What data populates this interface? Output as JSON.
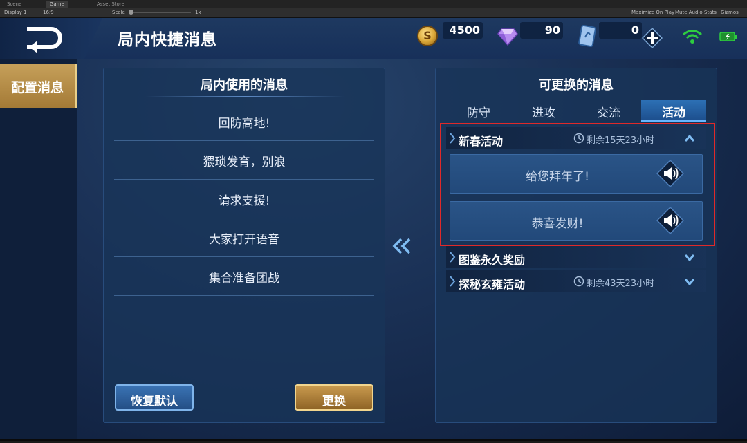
{
  "editor": {
    "tabs": [
      "Scene",
      "Game",
      "Asset Store"
    ],
    "display": "Display 1",
    "aspect": "16:9",
    "scale_label": "Scale",
    "scale_value": "1x",
    "right_items": [
      "Maximize On Play",
      "Mute Audio",
      "Stats",
      "Gizmos"
    ]
  },
  "header": {
    "title": "局内快捷消息",
    "gold": "4500",
    "diamonds": "90",
    "vouchers": "0"
  },
  "sidebar": {
    "tab_label": "配置消息"
  },
  "left_panel": {
    "title": "局内使用的消息",
    "messages": [
      "回防高地!",
      "猥琐发育，别浪",
      "请求支援!",
      "大家打开语音",
      "集合准备团战"
    ],
    "restore_label": "恢复默认",
    "replace_label": "更换"
  },
  "right_panel": {
    "title": "可更换的消息",
    "tabs": [
      "防守",
      "进攻",
      "交流",
      "活动"
    ],
    "active_tab": "活动",
    "categories": [
      {
        "name": "新春活动",
        "time": "剩余15天23小时",
        "expanded": true,
        "items": [
          "给您拜年了!",
          "恭喜发财!"
        ]
      },
      {
        "name": "图鉴永久奖励",
        "time": "",
        "expanded": false
      },
      {
        "name": "探秘玄雍活动",
        "time": "剩余43天23小时",
        "expanded": false
      }
    ]
  },
  "colors": {
    "accent_gold": "#c6a05a",
    "accent_blue": "#2d71b6",
    "highlight_red": "#e02929",
    "wifi_green": "#2ecc40"
  }
}
